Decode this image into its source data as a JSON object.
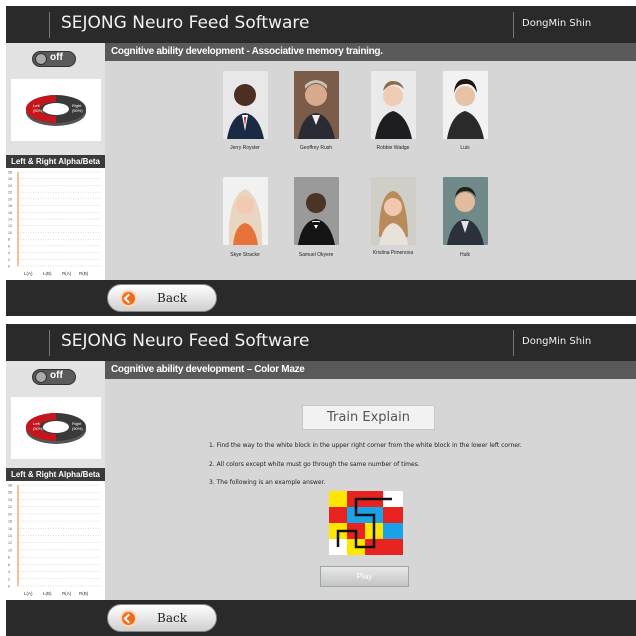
{
  "app": {
    "title": "SEJONG Neuro Feed Software",
    "user": "DongMin Shin"
  },
  "sidebar": {
    "toggle_label": "off",
    "donut": {
      "left_label": "Left\n(50%)",
      "right_label": "Right\n(50%)"
    },
    "chart_title": "Left & Right Alpha/Beta",
    "y_ticks": [
      "28",
      "26",
      "24",
      "22",
      "20",
      "18",
      "16",
      "14",
      "12",
      "10",
      "8",
      "6",
      "4",
      "2",
      "0"
    ],
    "x_ticks": [
      "L(A)",
      "L(B)",
      "R(A)",
      "R(B)"
    ]
  },
  "panel1": {
    "header": "Cognitive ability development - Associative memory training.",
    "people": [
      {
        "name": "Jerry Royster"
      },
      {
        "name": "Geoffrey Rush"
      },
      {
        "name": "Robbie Wadge"
      },
      {
        "name": "Luis"
      },
      {
        "name": "Skye Stracke"
      },
      {
        "name": "Samuel Okyere"
      },
      {
        "name": "Kristina Pimenova"
      },
      {
        "name": "Hulk"
      }
    ],
    "back_label": "Back"
  },
  "panel2": {
    "header": "Cognitive ability development – Color Maze",
    "train_title": "Train Explain",
    "instructions": [
      "1. Find the way to the white block in the upper right corner from the white block in the lower left corner.",
      "2. All colors except white must go through the same number of times.",
      "3. The following is an example answer."
    ],
    "play_label": "Play",
    "back_label": "Back"
  },
  "colors": {
    "titlebar": "#2a2a2a",
    "content_bg": "#d6d6d6",
    "header_bg": "#595959",
    "accent_orange": "#ef6c1e",
    "donut_red": "#c4161c",
    "maze_yellow": "#ffe600",
    "maze_red": "#e8231f",
    "maze_blue": "#1aa3e8",
    "maze_white": "#ffffff"
  }
}
